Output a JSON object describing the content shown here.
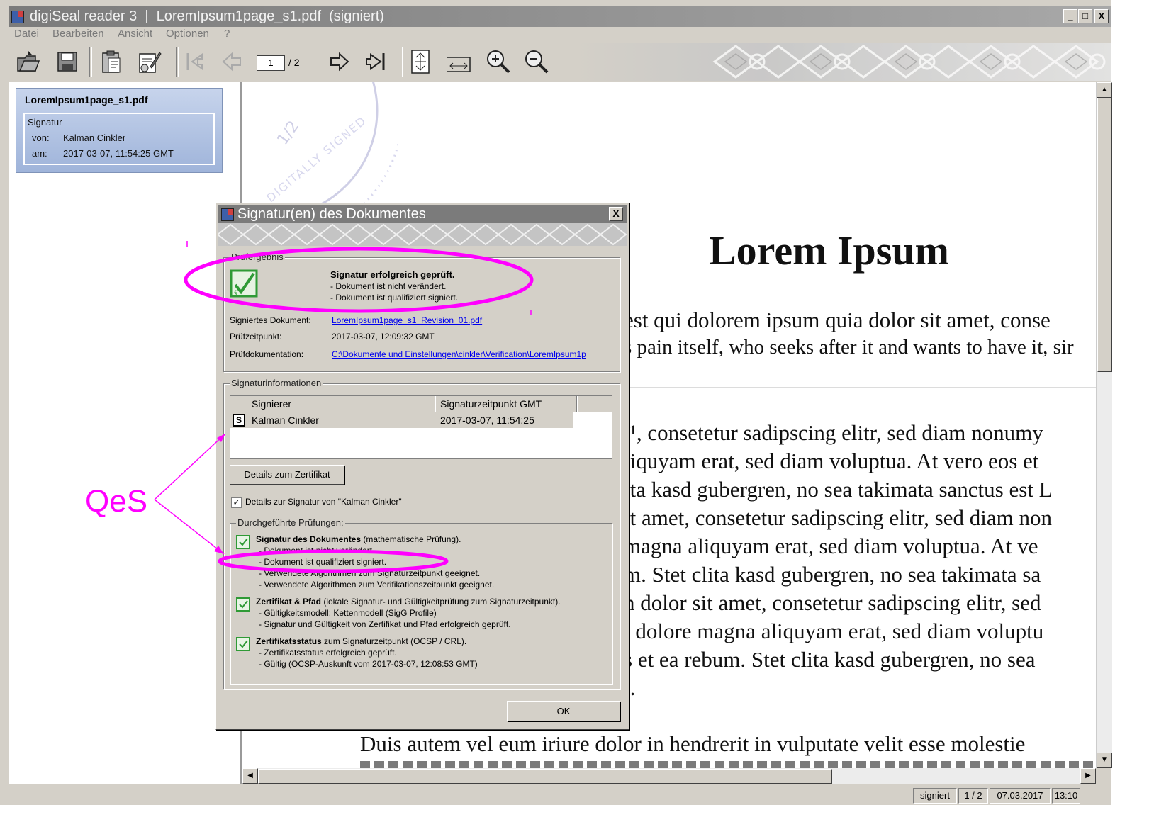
{
  "window": {
    "title": "digiSeal reader 3  |  LoremIpsum1page_s1.pdf  (signiert)",
    "controls": [
      "_",
      "□",
      "X"
    ]
  },
  "menu": [
    "Datei",
    "Bearbeiten",
    "Ansicht",
    "Optionen",
    "?"
  ],
  "toolbar": {
    "page_current": "1",
    "page_total": "/ 2",
    "icons": [
      "open-icon",
      "save-icon",
      "clipboard-icon",
      "signature-tool-icon",
      "first-page-icon",
      "previous-page-icon",
      "next-page-icon",
      "last-page-icon",
      "fit-page-icon",
      "fit-width-icon",
      "zoom-in-icon",
      "zoom-out-icon"
    ]
  },
  "sidebar": {
    "filename": "LoremIpsum1page_s1.pdf",
    "sig_heading": "Signatur",
    "von_label": "von:",
    "von_value": "Kalman Cinkler",
    "am_label": "am:",
    "am_value": "2017-03-07, 11:54:25 GMT"
  },
  "document": {
    "stamp_page": "1/2",
    "stamp_text": "DIGITALLY SIGNED",
    "heading": "Lorem Ipsum",
    "lines_top": [
      "est qui dolorem ipsum quia dolor sit amet, conse",
      "s pain itself, who seeks after it and wants to have it, sir"
    ],
    "lines_body": [
      "t¹, consetetur sadipscing elitr, sed diam nonumy",
      "liquyam erat, sed diam voluptua. At vero eos et",
      "ita kasd gubergren, no sea takimata sanctus est L",
      "it amet, consetetur sadipscing elitr, sed diam non",
      " magna aliquyam erat, sed diam voluptua. At ve",
      "m. Stet clita kasd gubergren, no sea takimata sa",
      "n dolor sit amet, consetetur sadipscing elitr, sed",
      "t dolore magna aliquyam erat, sed diam voluptu",
      "s et ea rebum. Stet clita kasd gubergren, no sea",
      "t."
    ],
    "line_bottom": "Duis autem vel eum iriure dolor in hendrerit in vulputate velit esse molestie"
  },
  "dialog": {
    "title": "Signatur(en) des Dokumentes",
    "close": "X",
    "pruef_group": "Prüfergebnis",
    "result_title": "Signatur erfolgreich geprüft.",
    "result_line1": "-  Dokument ist nicht verändert.",
    "result_line2": "-  Dokument ist qualifiziert signiert.",
    "signed_doc_label": "Signiertes Dokument:",
    "signed_doc_value": "LoremIpsum1page_s1_Revision_01.pdf",
    "pruefzeit_label": "Prüfzeitpunkt:",
    "pruefzeit_value": "2017-03-07, 12:09:32 GMT",
    "pruefdoku_label": "Prüfdokumentation:",
    "pruefdoku_value": "C:\\Dokumente und Einstellungen\\cinkler\\Verification\\LoremIpsum1p",
    "siginfo_group": "Signaturinformationen",
    "table_headers": [
      "Signierer",
      "Signaturzeitpunkt GMT"
    ],
    "table_row": {
      "icon": "S",
      "signer": "Kalman Cinkler",
      "time": "2017-03-07, 11:54:25"
    },
    "details_button": "Details zum Zertifikat",
    "details_checkbox": "Details zur Signatur von \"Kalman Cinkler\"",
    "checks_group": "Durchgeführte Prüfungen:",
    "check1_title": "Signatur des Dokumentes",
    "check1_suffix": " (mathematische Prüfung).",
    "check1_lines": [
      "-  Dokument ist nicht verändert.",
      "-  Dokument ist qualifiziert signiert.",
      "-  Verwendete Algorithmen zum Signaturzeitpunkt geeignet.",
      "-  Verwendete Algorithmen zum Verifikationszeitpunkt geeignet."
    ],
    "check2_title": "Zertifikat & Pfad",
    "check2_suffix": " (lokale Signatur- und Gültigkeitprüfung zum Signaturzeitpunkt).",
    "check2_lines": [
      "-  Gültigkeitsmodell: Kettenmodell (SigG Profile)",
      "-  Signatur und Gültigkeit von Zertifikat und Pfad erfolgreich geprüft."
    ],
    "check3_title": "Zertifikatsstatus",
    "check3_suffix": " zum Signaturzeitpunkt (OCSP / CRL).",
    "check3_lines": [
      "-  Zertifikatsstatus erfolgreich geprüft.",
      "-  Gültig  (OCSP-Auskunft vom 2017-03-07, 12:08:53 GMT)"
    ],
    "ok_button": "OK"
  },
  "annotation": {
    "label": "QeS",
    "color": "#ff00ff"
  },
  "statusbar": {
    "status": "signiert",
    "pages": "1 / 2",
    "date": "07.03.2017",
    "time": "13:10"
  }
}
